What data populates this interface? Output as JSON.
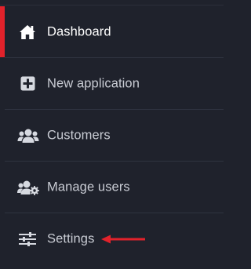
{
  "sidebar": {
    "items": [
      {
        "label": "Dashboard",
        "icon": "home-icon",
        "active": true
      },
      {
        "label": "New application",
        "icon": "plus-square-icon",
        "active": false
      },
      {
        "label": "Customers",
        "icon": "users-icon",
        "active": false
      },
      {
        "label": "Manage users",
        "icon": "users-cog-icon",
        "active": false
      },
      {
        "label": "Settings",
        "icon": "sliders-icon",
        "active": false
      }
    ]
  },
  "annotation": {
    "icon": "red-arrow-icon",
    "color": "#e2222b"
  },
  "colors": {
    "background": "#1f222c",
    "active_indicator": "#e2222b",
    "text": "#c9ccd4",
    "active_text": "#ffffff"
  }
}
